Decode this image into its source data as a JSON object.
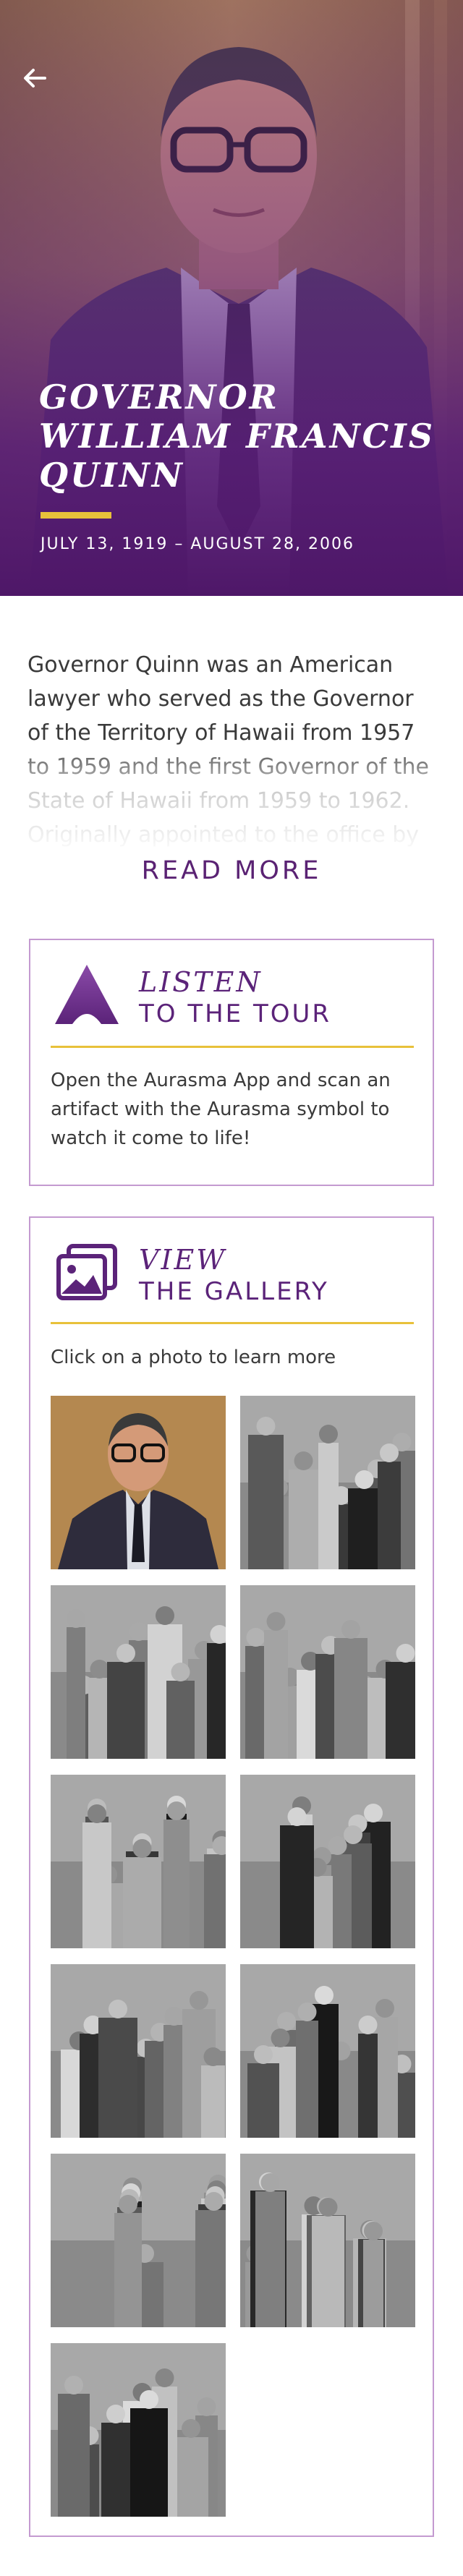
{
  "hero": {
    "back_icon": "arrow-left-icon",
    "title_lines": [
      "GOVERNOR",
      "WILLIAM FRANCIS",
      "QUINN"
    ],
    "dates": "JULY 13, 1919 – AUGUST 28, 2006",
    "accent_color": "#e8c13a",
    "overlay_color": "#5a1f78"
  },
  "intro": {
    "text": "Governor Quinn was an American lawyer who served as the Governor of the Territory of Hawaii from 1957 to 1959 and the first Governor of the State of Hawaii from 1959 to 1962. Originally appointed to the office by",
    "read_more_label": "READ MORE"
  },
  "listen_card": {
    "icon": "aurasma-a-icon",
    "title_italic": "LISTEN",
    "title": "TO THE TOUR",
    "body": "Open the Aurasma App and scan an artifact with the Aurasma symbol to watch it come to life!"
  },
  "gallery_card": {
    "icon": "photo-gallery-icon",
    "title_italic": "VIEW",
    "title": "THE GALLERY",
    "body": "Click on a photo to learn more",
    "photos": [
      {
        "name": "gallery-photo-portrait",
        "style": "color"
      },
      {
        "name": "gallery-photo-group-outdoors",
        "style": "bw"
      },
      {
        "name": "gallery-photo-woman-at-desk",
        "style": "bw"
      },
      {
        "name": "gallery-photo-dinner-table",
        "style": "bw"
      },
      {
        "name": "gallery-photo-woman-with-child",
        "style": "bw"
      },
      {
        "name": "gallery-photo-crowd",
        "style": "bw"
      },
      {
        "name": "gallery-photo-family-gathering",
        "style": "bw"
      },
      {
        "name": "gallery-photo-signing",
        "style": "bw"
      },
      {
        "name": "gallery-photo-family-standing",
        "style": "bw"
      },
      {
        "name": "gallery-photo-lei-greeting",
        "style": "bw"
      },
      {
        "name": "gallery-photo-children-christmas",
        "style": "bw"
      }
    ]
  },
  "colors": {
    "brand_purple": "#5b2379",
    "card_border": "#c49ad0",
    "accent_yellow": "#e8c13a"
  }
}
